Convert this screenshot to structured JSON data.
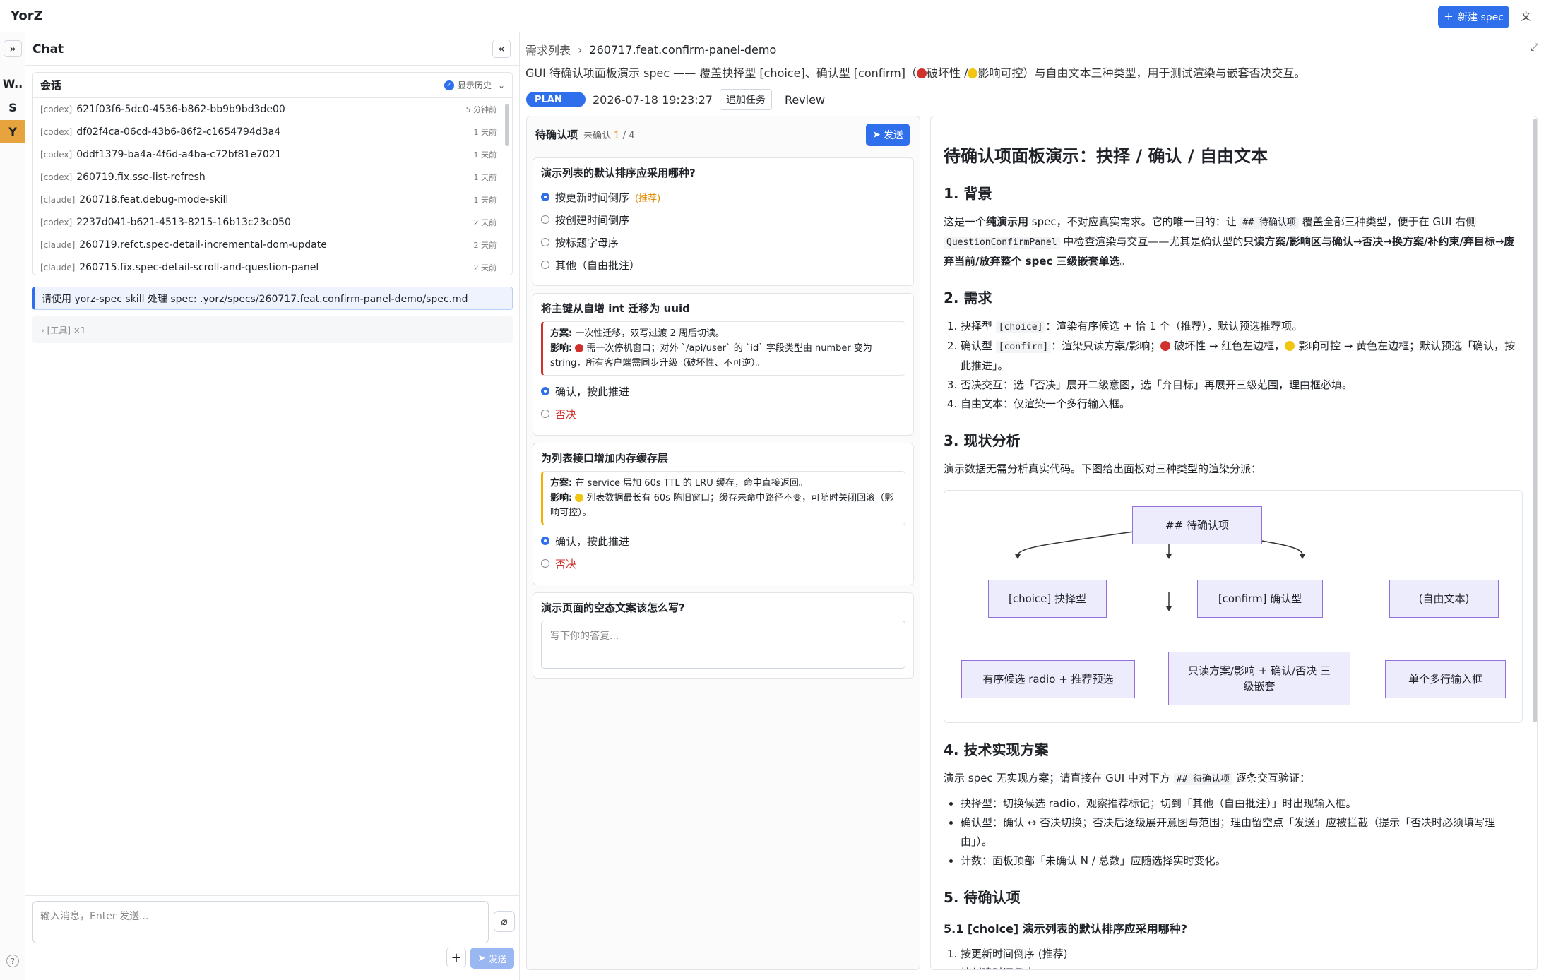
{
  "app": {
    "brand": "YorZ",
    "new_spec": "新建 spec"
  },
  "rail": {
    "items": [
      "W..",
      "S",
      "Y"
    ]
  },
  "chat": {
    "title": "Chat",
    "sessions_title": "会话",
    "show_history": "显示历史",
    "sessions": [
      {
        "tag": "[codex]",
        "name": "621f03f6-5dc0-4536-b862-bb9b9bd3de00",
        "time": "5 分钟前"
      },
      {
        "tag": "[codex]",
        "name": "df02f4ca-06cd-43b6-86f2-c1654794d3a4",
        "time": "1 天前"
      },
      {
        "tag": "[codex]",
        "name": "0ddf1379-ba4a-4f6d-a4ba-c72bf81e7021",
        "time": "1 天前"
      },
      {
        "tag": "[codex]",
        "name": "260719.fix.sse-list-refresh",
        "time": "1 天前"
      },
      {
        "tag": "[claude]",
        "name": "260718.feat.debug-mode-skill",
        "time": "1 天前"
      },
      {
        "tag": "[codex]",
        "name": "2237d041-b621-4513-8215-16b13c23e050",
        "time": "2 天前"
      },
      {
        "tag": "[claude]",
        "name": "260719.refct.spec-detail-incremental-dom-update",
        "time": "2 天前"
      },
      {
        "tag": "[claude]",
        "name": "260715.fix.spec-detail-scroll-and-question-panel",
        "time": "2 天前"
      }
    ],
    "user_message": "请使用 yorz-spec skill 处理 spec: .yorz/specs/260717.feat.confirm-panel-demo/spec.md",
    "tool_summary": "› [工具] ×1",
    "input_placeholder": "输入消息，Enter 发送...",
    "send": "发送"
  },
  "main": {
    "breadcrumb_root": "需求列表",
    "breadcrumb_current": "260717.feat.confirm-panel-demo",
    "desc_part1": "GUI 待确认项面板演示 spec —— 覆盖抉择型 [choice]、确认型 [confirm]（",
    "desc_part2": "破坏性 /",
    "desc_part3": "影响可控）与自由文本三种类型，用于测试渲染与嵌套否决交互。",
    "status": "PLAN",
    "timestamp": "2026-07-18 19:23:27",
    "add_task": "追加任务",
    "review": "Review"
  },
  "questions": {
    "title": "待确认项",
    "unconfirmed_label": "未确认",
    "unconfirmed_count": "1",
    "total": "/ 4",
    "send": "发送",
    "q1": {
      "title": "演示列表的默认排序应采用哪种?",
      "options": [
        "按更新时间倒序",
        "按创建时间倒序",
        "按标题字母序",
        "其他（自由批注）"
      ],
      "recommended": "(推荐)"
    },
    "q2": {
      "title": "将主键从自增 int 迁移为 uuid",
      "plan_label": "方案:",
      "plan": "一次性迁移，双写过渡 2 周后切读。",
      "impact_label": "影响:",
      "impact": "需一次停机窗口；对外 `/api/user` 的 `id` 字段类型由 number 变为 string，所有客户端需同步升级（破坏性、不可逆）。",
      "confirm": "确认，按此推进",
      "reject": "否决"
    },
    "q3": {
      "title": "为列表接口增加内存缓存层",
      "plan_label": "方案:",
      "plan": "在 service 层加 60s TTL 的 LRU 缓存，命中直接返回。",
      "impact_label": "影响:",
      "impact": "列表数据最长有 60s 陈旧窗口；缓存未命中路径不变，可随时关闭回滚（影响可控）。",
      "confirm": "确认，按此推进",
      "reject": "否决"
    },
    "q4": {
      "title": "演示页面的空态文案该怎么写?",
      "placeholder": "写下你的答复..."
    }
  },
  "doc": {
    "h1": "待确认项面板演示：抉择 / 确认 / 自由文本",
    "s1": "1. 背景",
    "s1_p_a": "这是一个",
    "s1_p_b": "纯演示用",
    "s1_p_c": " spec，不对应真实需求。它的唯一目的：让 ",
    "s1_code1": "## 待确认项",
    "s1_p_d": " 覆盖全部三种类型，便于在 GUI 右侧 ",
    "s1_code2": "QuestionConfirmPanel",
    "s1_p_e": " 中检查渲染与交互——尤其是确认型的",
    "s1_p_f": "只读方案/影响区",
    "s1_p_g": "与",
    "s1_p_h": "确认→否决→换方案/补约束/弃目标→废弃当前/放弃整个 spec 三级嵌套单选",
    "s1_p_i": "。",
    "s2": "2. 需求",
    "s2_li1_a": "抉择型 ",
    "s2_li1_code": "[choice]",
    "s2_li1_b": "：渲染有序候选 + 恰 1 个（推荐），默认预选推荐项。",
    "s2_li2_a": "确认型 ",
    "s2_li2_code": "[confirm]",
    "s2_li2_b": "：渲染只读方案/影响；",
    "s2_li2_c": "破坏性 → 红色左边框，",
    "s2_li2_d": "影响可控 → 黄色左边框；默认预选「确认，按此推进」。",
    "s2_li3": "否决交互：选「否决」展开二级意图，选「弃目标」再展开三级范围，理由框必填。",
    "s2_li4": "自由文本：仅渲染一个多行输入框。",
    "s3": "3. 现状分析",
    "s3_p": "演示数据无需分析真实代码。下图给出面板对三种类型的渲染分派：",
    "diagram": {
      "root": "## 待确认项",
      "n1": "[choice] 抉择型",
      "n2": "[confirm] 确认型",
      "n3": "(自由文本)",
      "l1": "有序候选 radio + 推荐预选",
      "l2": "只读方案/影响 + 确认/否决 三级嵌套",
      "l3": "单个多行输入框"
    },
    "s4": "4. 技术实现方案",
    "s4_p_a": "演示 spec 无实现方案；请直接在 GUI 中对下方 ",
    "s4_code": "## 待确认项",
    "s4_p_b": " 逐条交互验证：",
    "s4_li1": "抉择型：切换候选 radio，观察推荐标记；切到「其他（自由批注）」时出现输入框。",
    "s4_li2": "确认型：确认 ↔ 否决切换；否决后逐级展开意图与范围；理由留空点「发送」应被拦截（提示「否决时必须填写理由」）。",
    "s4_li3": "计数：面板顶部「未确认 N / 总数」应随选择实时变化。",
    "s5": "5. 待确认项",
    "s51": "5.1 [choice] 演示列表的默认排序应采用哪种?",
    "s51_li1": "按更新时间倒序 (推荐)",
    "s51_li2": "按创建时间倒序"
  }
}
